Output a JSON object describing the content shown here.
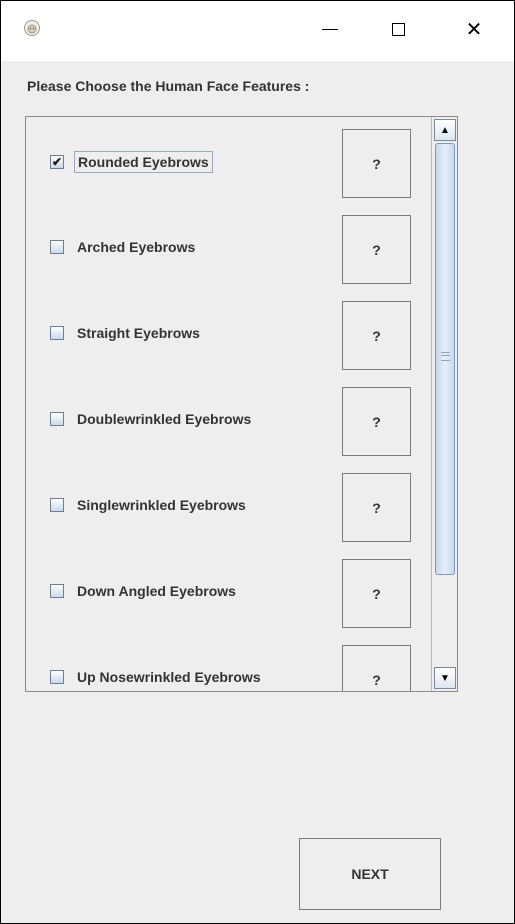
{
  "titlebar": {
    "minimize_glyph": "",
    "maximize_glyph": "",
    "close_glyph": "✕"
  },
  "prompt": "Please Choose the Human Face Features :",
  "features": [
    {
      "label": "Rounded Eyebrows",
      "checked": true,
      "help": "?"
    },
    {
      "label": "Arched Eyebrows",
      "checked": false,
      "help": "?"
    },
    {
      "label": "Straight Eyebrows",
      "checked": false,
      "help": "?"
    },
    {
      "label": "Doublewrinkled Eyebrows",
      "checked": false,
      "help": "?"
    },
    {
      "label": "Singlewrinkled Eyebrows",
      "checked": false,
      "help": "?"
    },
    {
      "label": "Down Angled Eyebrows",
      "checked": false,
      "help": "?"
    },
    {
      "label": "Up Nosewrinkled Eyebrows",
      "checked": false,
      "help": "?"
    }
  ],
  "scrollbar": {
    "up_glyph": "▲",
    "down_glyph": "▼"
  },
  "next_label": "NEXT",
  "icons": {
    "app": "lion-head-icon",
    "minimize": "minimize-icon",
    "maximize": "maximize-icon",
    "close": "close-icon"
  }
}
